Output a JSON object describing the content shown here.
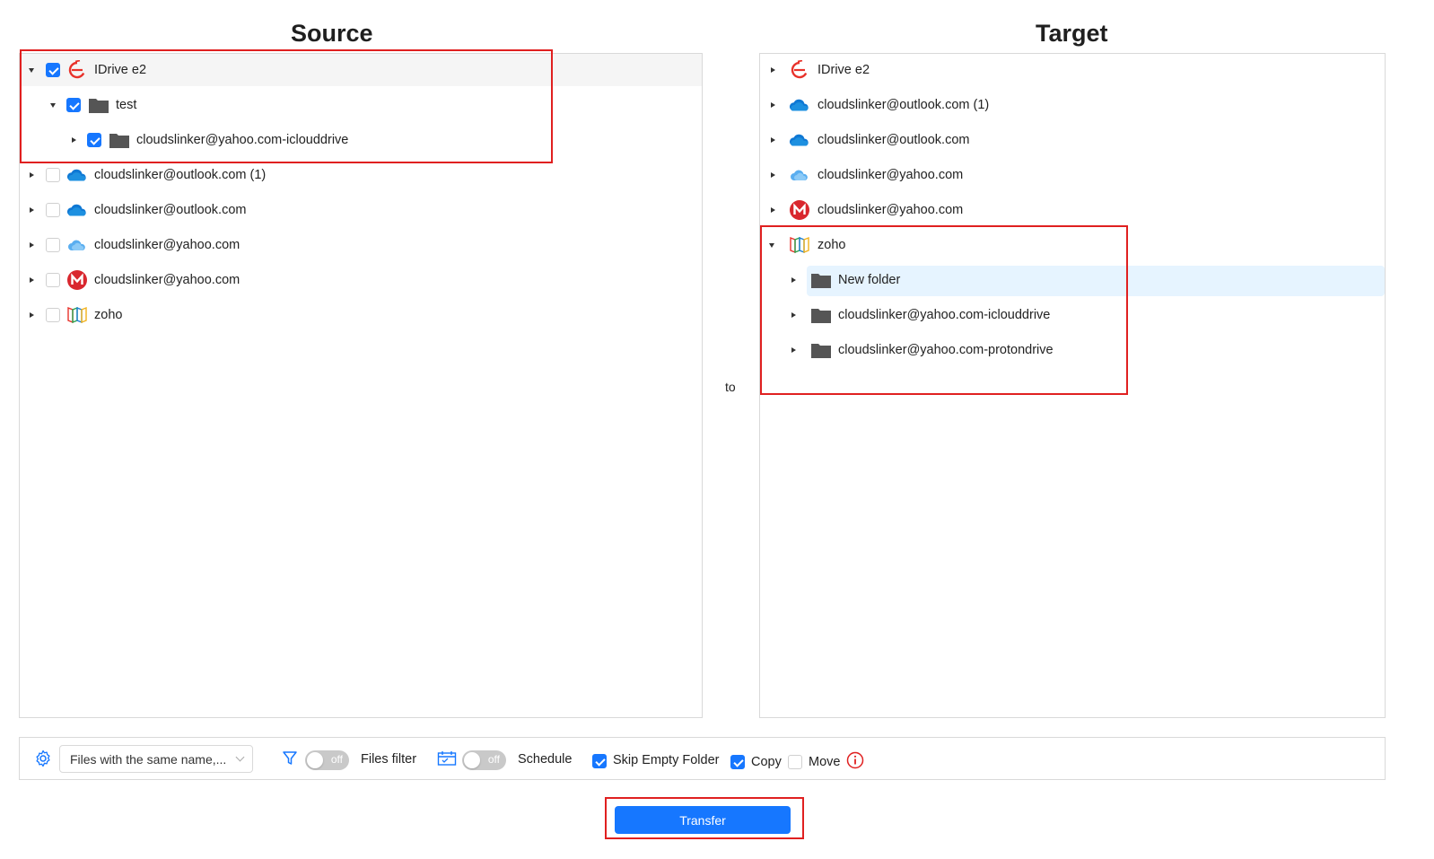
{
  "headings": {
    "source": "Source",
    "target": "Target",
    "to": "to"
  },
  "source": {
    "items": [
      {
        "label": "IDrive e2",
        "expanded": true,
        "checked": true,
        "icon": "idrive-e2-icon"
      },
      {
        "label": "test",
        "expanded": true,
        "checked": true,
        "icon": "folder-icon"
      },
      {
        "label": "cloudslinker@yahoo.com-iclouddrive",
        "expanded": false,
        "checked": true,
        "icon": "folder-icon"
      },
      {
        "label": "cloudslinker@outlook.com (1)",
        "expanded": false,
        "checked": false,
        "icon": "onedrive-icon"
      },
      {
        "label": "cloudslinker@outlook.com",
        "expanded": false,
        "checked": false,
        "icon": "onedrive-icon"
      },
      {
        "label": "cloudslinker@yahoo.com",
        "expanded": false,
        "checked": false,
        "icon": "icloud-icon"
      },
      {
        "label": "cloudslinker@yahoo.com",
        "expanded": false,
        "checked": false,
        "icon": "mega-icon"
      },
      {
        "label": "zoho",
        "expanded": false,
        "checked": false,
        "icon": "zoho-icon"
      }
    ]
  },
  "target": {
    "items": [
      {
        "label": "IDrive e2",
        "expanded": false,
        "icon": "idrive-e2-icon"
      },
      {
        "label": "cloudslinker@outlook.com (1)",
        "expanded": false,
        "icon": "onedrive-icon"
      },
      {
        "label": "cloudslinker@outlook.com",
        "expanded": false,
        "icon": "onedrive-icon"
      },
      {
        "label": "cloudslinker@yahoo.com",
        "expanded": false,
        "icon": "icloud-icon"
      },
      {
        "label": "cloudslinker@yahoo.com",
        "expanded": false,
        "icon": "mega-icon"
      },
      {
        "label": "zoho",
        "expanded": true,
        "icon": "zoho-icon"
      },
      {
        "label": "New folder",
        "expanded": false,
        "selected": true,
        "icon": "folder-icon"
      },
      {
        "label": "cloudslinker@yahoo.com-iclouddrive",
        "expanded": false,
        "icon": "folder-icon"
      },
      {
        "label": "cloudslinker@yahoo.com-protondrive",
        "expanded": false,
        "icon": "folder-icon"
      }
    ]
  },
  "toolbar": {
    "same_name_select": "Files with the same name,...",
    "filter_toggle": "off",
    "filter_label": "Files filter",
    "schedule_toggle": "off",
    "schedule_label": "Schedule",
    "skip_empty_label": "Skip Empty Folder",
    "skip_empty_checked": true,
    "copy_label": "Copy",
    "copy_checked": true,
    "move_label": "Move",
    "move_checked": false
  },
  "transfer_label": "Transfer",
  "colors": {
    "accent": "#1677ff",
    "annotation_red": "#e02020",
    "idrive_red": "#e8322b",
    "onedrive_blue": "#0f78d4",
    "mega_red": "#d9272e"
  }
}
